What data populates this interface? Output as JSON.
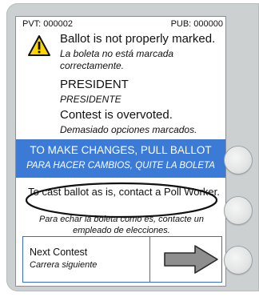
{
  "header": {
    "pvt": "PVT: 000002",
    "pub": "PUB: 000000"
  },
  "warning": {
    "icon": "warning-triangle-icon",
    "title_en": "Ballot is not properly marked.",
    "title_es": "La boleta no está marcada correctamente."
  },
  "contest": {
    "name_en": "PRESIDENT",
    "name_es": "PRESIDENTE",
    "status_en": "Contest is overvoted.",
    "status_es": "Demasiado opciones marcados."
  },
  "banner": {
    "text_en": "TO MAKE CHANGES, PULL BALLOT",
    "text_es": "PARA HACER CAMBIOS, QUITE LA BOLETA",
    "color": "#3b7bd5"
  },
  "cast_option": {
    "text_en": "To cast ballot as is, contact a Poll Worker.",
    "text_es": "Para echar la boleta como es, contacte un empleado de elecciones."
  },
  "next": {
    "label_en": "Next Contest",
    "label_es": "Carrera siguiente",
    "icon": "arrow-right-icon"
  },
  "hardware_buttons": [
    "side-button-top",
    "side-button-middle",
    "side-button-bottom"
  ]
}
